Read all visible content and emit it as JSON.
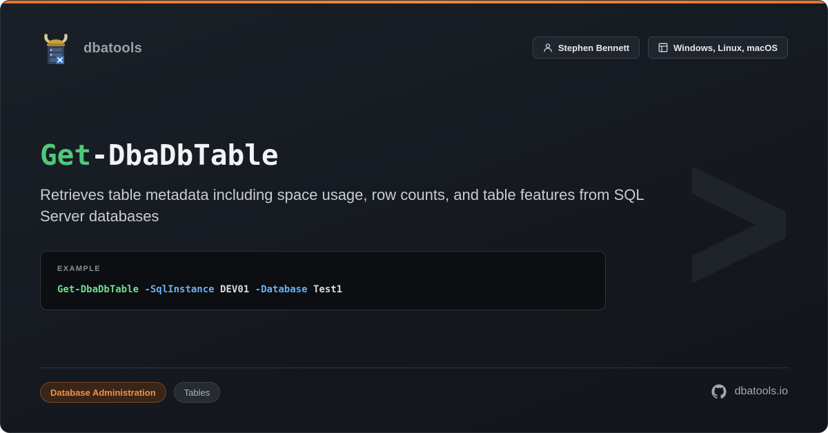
{
  "brand": {
    "name": "dbatools",
    "logo_icon": "viking-helmet-server-icon"
  },
  "header": {
    "author": "Stephen Bennett",
    "author_icon": "user-icon",
    "platforms": "Windows, Linux, macOS",
    "platforms_icon": "window-layout-icon"
  },
  "command": {
    "verb": "Get",
    "noun": "-DbaDbTable",
    "description": "Retrieves table metadata including space usage, row counts, and table features from SQL Server databases"
  },
  "example": {
    "label": "EXAMPLE",
    "command": "Get-DbaDbTable",
    "param1": "-SqlInstance",
    "value1": "DEV01",
    "param2": "-Database",
    "value2": "Test1"
  },
  "footer": {
    "tags": [
      "Database Administration",
      "Tables"
    ],
    "site": "dbatools.io",
    "site_icon": "github-icon"
  },
  "colors": {
    "accent": "#e8742c",
    "verb": "#4ec97a",
    "param": "#6aaef0",
    "background": "#161a21"
  }
}
